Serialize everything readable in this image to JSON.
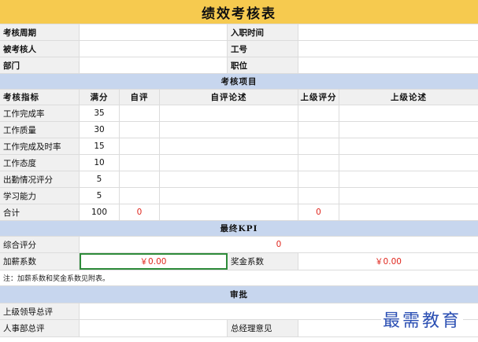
{
  "title": "绩效考核表",
  "info": {
    "period_label": "考核周期",
    "hire_date_label": "入职时间",
    "assessee_label": "被考核人",
    "employee_id_label": "工号",
    "department_label": "部门",
    "position_label": "职位"
  },
  "section_items": "考核项目",
  "columns": {
    "indicator": "考核指标",
    "full_score": "满分",
    "self_score": "自评",
    "self_comment": "自评论述",
    "manager_score": "上级评分",
    "manager_comment": "上级论述"
  },
  "rows": [
    {
      "indicator": "工作完成率",
      "full": "35",
      "self": "",
      "mgr": ""
    },
    {
      "indicator": "工作质量",
      "full": "30",
      "self": "",
      "mgr": ""
    },
    {
      "indicator": "工作完成及时率",
      "full": "15",
      "self": "",
      "mgr": ""
    },
    {
      "indicator": "工作态度",
      "full": "10",
      "self": "",
      "mgr": ""
    },
    {
      "indicator": "出勤情况评分",
      "full": "5",
      "self": "",
      "mgr": ""
    },
    {
      "indicator": "学习能力",
      "full": "5",
      "self": "",
      "mgr": ""
    },
    {
      "indicator": "合计",
      "full": "100",
      "self": "0",
      "mgr": "0"
    }
  ],
  "section_kpi": "最终KPI",
  "kpi": {
    "overall_label": "综合评分",
    "overall_value": "0",
    "raise_label": "加薪系数",
    "raise_value": "￥0.00",
    "bonus_label": "奖金系数",
    "bonus_value": "￥0.00"
  },
  "note": "注：加薪系数和奖金系数见附表。",
  "section_approval": "审批",
  "approval": {
    "leader_label": "上级领导总评",
    "hr_label": "人事部总评",
    "gm_label": "总经理意见"
  },
  "watermark": "最需教育",
  "colors": {
    "title_bg": "#f6ca4f",
    "section_bg": "#c7d6ee",
    "label_bg": "#f0f0f0",
    "accent_red": "#e0261d",
    "selection": "#2e8b3a"
  }
}
